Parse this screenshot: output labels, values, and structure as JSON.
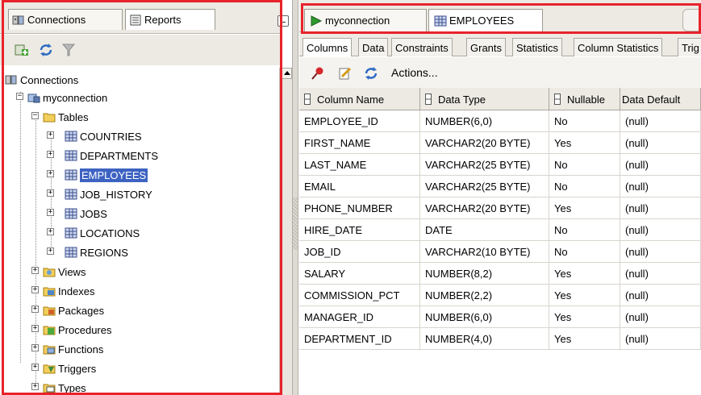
{
  "left_panel": {
    "tabs": [
      {
        "label": "Connections",
        "icon": "connections-icon"
      },
      {
        "label": "Reports",
        "icon": "reports-icon"
      }
    ],
    "toolbar": {
      "icons": [
        "add-connection-icon",
        "refresh-icon",
        "filter-icon"
      ]
    },
    "tree": {
      "root": "Connections",
      "connection": "myconnection",
      "tables_folder": "Tables",
      "tables": [
        "COUNTRIES",
        "DEPARTMENTS",
        "EMPLOYEES",
        "JOB_HISTORY",
        "JOBS",
        "LOCATIONS",
        "REGIONS"
      ],
      "selected_table": "EMPLOYEES",
      "other_folders": [
        "Views",
        "Indexes",
        "Packages",
        "Procedures",
        "Functions",
        "Triggers",
        "Types"
      ],
      "expander_plus": "+",
      "expander_minus": "−"
    }
  },
  "editor": {
    "tabs": [
      {
        "label": "myconnection",
        "icon": "run-icon"
      },
      {
        "label": "EMPLOYEES",
        "icon": "table-icon"
      }
    ],
    "subtabs": [
      "Columns",
      "Data",
      "Constraints",
      "Grants",
      "Statistics",
      "Column Statistics",
      "Trig"
    ],
    "active_subtab": "Columns",
    "actions_label": "Actions...",
    "grid": {
      "headers": [
        "Column Name",
        "Data Type",
        "Nullable",
        "Data Default"
      ],
      "rows": [
        [
          "EMPLOYEE_ID",
          "NUMBER(6,0)",
          "No",
          "(null)"
        ],
        [
          "FIRST_NAME",
          "VARCHAR2(20 BYTE)",
          "Yes",
          "(null)"
        ],
        [
          "LAST_NAME",
          "VARCHAR2(25 BYTE)",
          "No",
          "(null)"
        ],
        [
          "EMAIL",
          "VARCHAR2(25 BYTE)",
          "No",
          "(null)"
        ],
        [
          "PHONE_NUMBER",
          "VARCHAR2(20 BYTE)",
          "Yes",
          "(null)"
        ],
        [
          "HIRE_DATE",
          "DATE",
          "No",
          "(null)"
        ],
        [
          "JOB_ID",
          "VARCHAR2(10 BYTE)",
          "No",
          "(null)"
        ],
        [
          "SALARY",
          "NUMBER(8,2)",
          "Yes",
          "(null)"
        ],
        [
          "COMMISSION_PCT",
          "NUMBER(2,2)",
          "Yes",
          "(null)"
        ],
        [
          "MANAGER_ID",
          "NUMBER(6,0)",
          "Yes",
          "(null)"
        ],
        [
          "DEPARTMENT_ID",
          "NUMBER(4,0)",
          "Yes",
          "(null)"
        ]
      ]
    }
  },
  "colors": {
    "highlight_frame": "#e8232b",
    "selection": "#3d63c2",
    "panel_bg": "#eceae3"
  }
}
